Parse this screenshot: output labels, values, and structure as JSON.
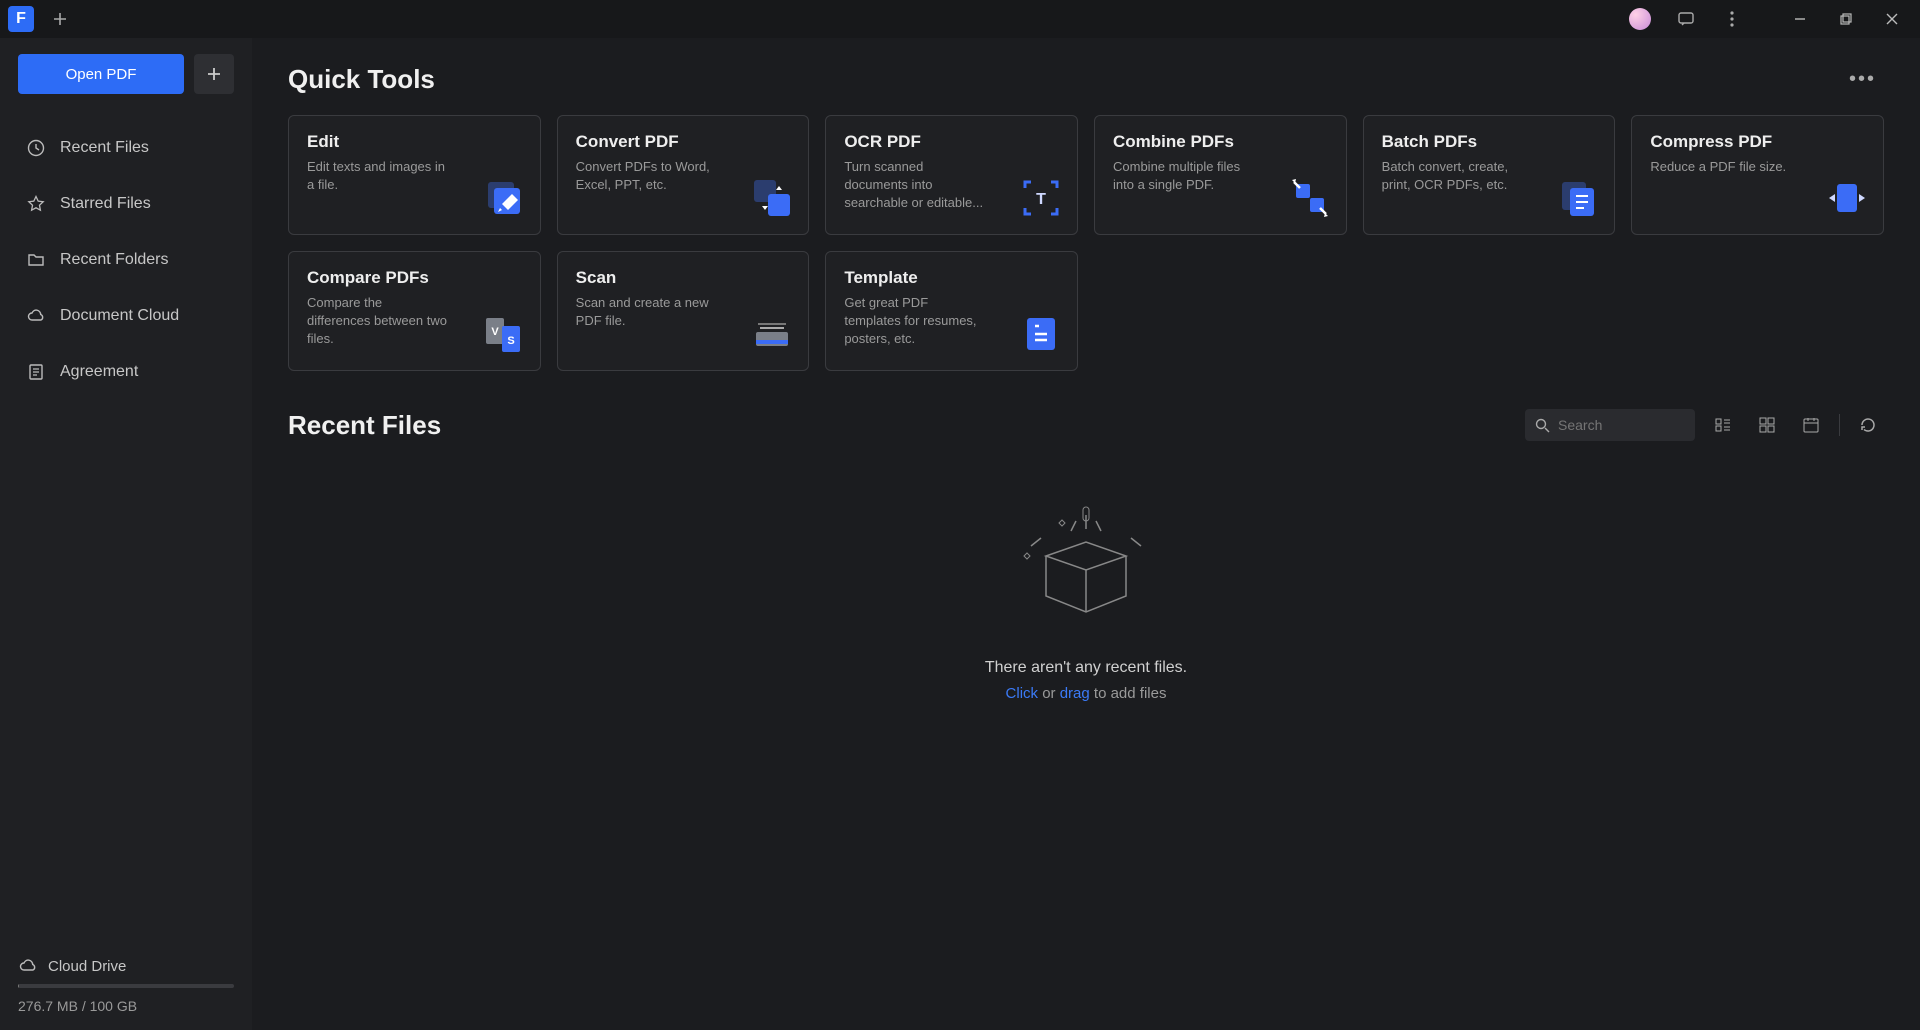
{
  "titlebar": {
    "app_glyph": "F"
  },
  "sidebar": {
    "open_pdf_label": "Open PDF",
    "nav": [
      {
        "label": "Recent Files",
        "icon": "clock"
      },
      {
        "label": "Starred Files",
        "icon": "star"
      },
      {
        "label": "Recent Folders",
        "icon": "folder"
      },
      {
        "label": "Document Cloud",
        "icon": "cloud"
      },
      {
        "label": "Agreement",
        "icon": "doc"
      }
    ],
    "cloud_label": "Cloud Drive",
    "storage_text": "276.7 MB / 100 GB"
  },
  "quick_tools": {
    "title": "Quick Tools",
    "cards": [
      {
        "title": "Edit",
        "desc": "Edit texts and images in a file."
      },
      {
        "title": "Convert PDF",
        "desc": "Convert PDFs to Word, Excel, PPT, etc."
      },
      {
        "title": "OCR PDF",
        "desc": "Turn scanned documents into searchable or editable..."
      },
      {
        "title": "Combine PDFs",
        "desc": "Combine multiple files into a single PDF."
      },
      {
        "title": "Batch PDFs",
        "desc": "Batch convert, create, print, OCR PDFs, etc."
      },
      {
        "title": "Compress PDF",
        "desc": "Reduce a PDF file size."
      },
      {
        "title": "Compare PDFs",
        "desc": "Compare the differences between two files."
      },
      {
        "title": "Scan",
        "desc": "Scan and create a new PDF file."
      },
      {
        "title": "Template",
        "desc": "Get great PDF templates for resumes, posters, etc."
      }
    ]
  },
  "recent": {
    "title": "Recent Files",
    "search_placeholder": "Search",
    "empty_main": "There aren't any recent files.",
    "empty_click": "Click",
    "empty_or": " or ",
    "empty_drag": "drag",
    "empty_tail": " to add files"
  }
}
